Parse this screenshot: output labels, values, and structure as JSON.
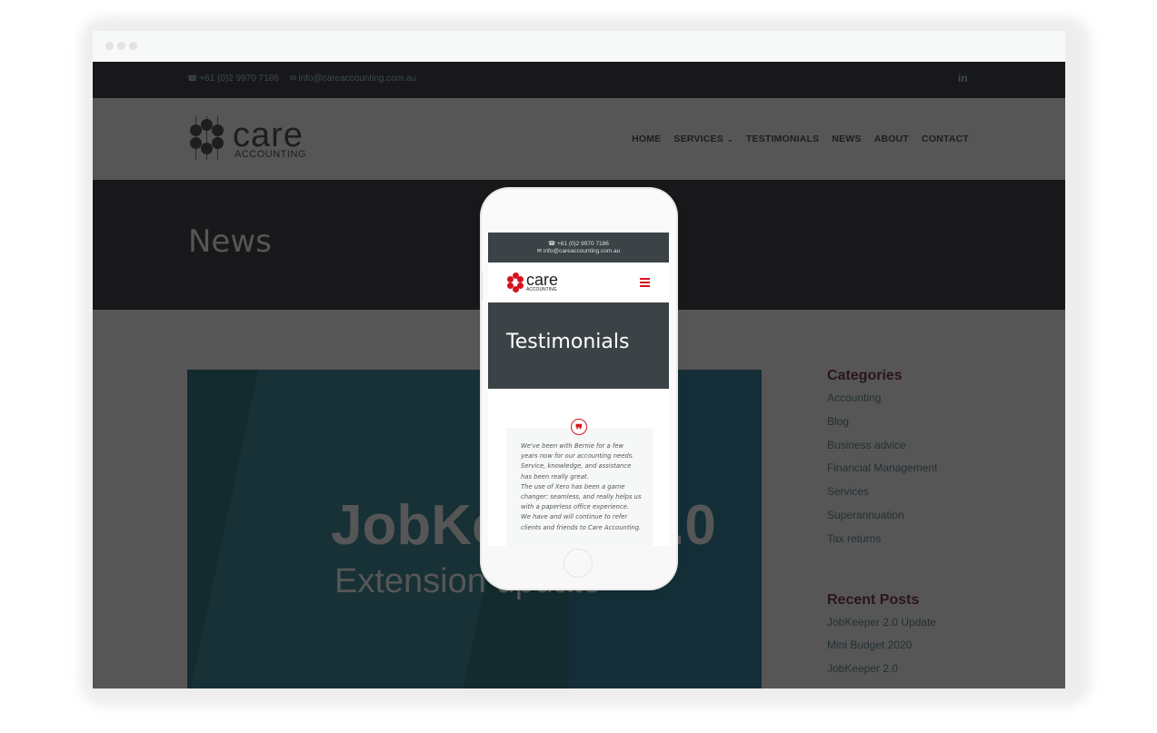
{
  "browser": {
    "window_controls": [
      "close",
      "minimize",
      "maximize"
    ]
  },
  "topbar": {
    "phone": "+61 (0)2 9970 7186",
    "email": "info@careaccounting.com.au",
    "phone_icon": "☎",
    "email_icon": "✉",
    "social_linkedin": "in"
  },
  "header": {
    "logo_word": "care",
    "logo_sub": "ACCOUNTING",
    "nav": [
      {
        "label": "HOME"
      },
      {
        "label": "SERVICES",
        "has_dropdown": true
      },
      {
        "label": "TESTIMONIALS"
      },
      {
        "label": "NEWS"
      },
      {
        "label": "ABOUT"
      },
      {
        "label": "CONTACT"
      }
    ],
    "dropdown_glyph": "⌄"
  },
  "page": {
    "title": "News"
  },
  "featured_post": {
    "headline": "JobKeeper 2.0",
    "subheadline": "Extension update"
  },
  "sidebar": {
    "categories_title": "Categories",
    "categories": [
      "Accounting",
      "Blog",
      "Business advice",
      "Financial Management",
      "Services",
      "Superannuation",
      "Tax returns"
    ],
    "recent_title": "Recent Posts",
    "recent_posts": [
      "JobKeeper 2.0 Update",
      "Mini Budget 2020",
      "JobKeeper 2.0"
    ]
  },
  "mobile": {
    "phone": "+61 (0)2 9970 7186",
    "email": "info@careaccounting.com.au",
    "logo_word": "care",
    "logo_sub": "ACCOUNTING",
    "page_title": "Testimonials",
    "quote_glyph": "❞",
    "testimonial": "We've been with Bernie for a few years now for our accounting needs. Service, knowledge, and assistance has been really great.\nThe use of Xero has been a game changer: seamless, and really helps us with a paperless office experience.\nWe have and will continue to refer clients and friends to Care Accounting."
  },
  "colors": {
    "brand_red": "#d7121f",
    "dark_bar": "#18181b",
    "mobile_header": "#3c4347",
    "overlay_gray": "#565656"
  }
}
